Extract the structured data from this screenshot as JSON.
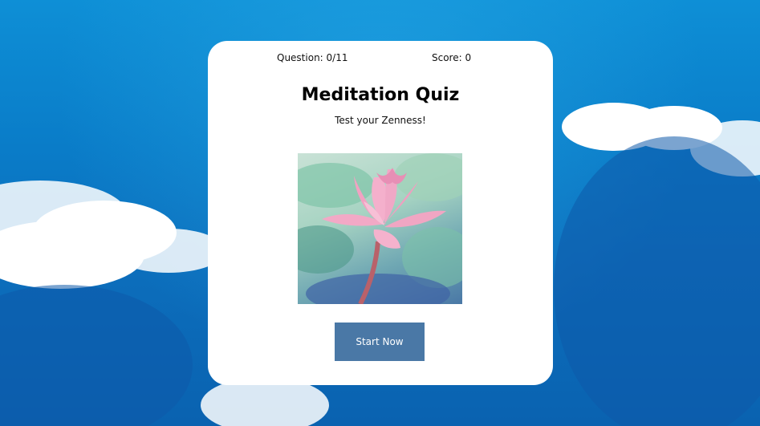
{
  "quiz": {
    "question_label": "Question: 0/11",
    "score_label": "Score: 0",
    "title": "Meditation Quiz",
    "subtitle": "Test your Zenness!",
    "start_button_label": "Start Now",
    "image_subject": "pink-lotus-flower"
  },
  "colors": {
    "sky": "#0a7cc8",
    "card": "#ffffff",
    "button": "#4a78a6",
    "button_text": "#ffffff"
  }
}
